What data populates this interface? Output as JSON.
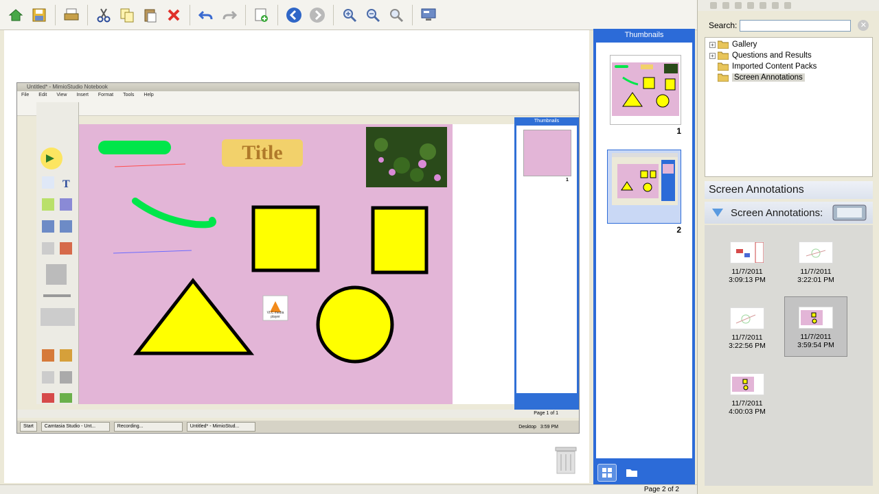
{
  "toolbar": {
    "buttons": [
      "home-icon",
      "save-icon",
      "print-icon",
      "cut-icon",
      "copy-icon",
      "paste-icon",
      "delete-icon",
      "undo-icon",
      "redo-icon",
      "new-page-icon",
      "back-icon",
      "forward-icon",
      "zoom-in-icon",
      "zoom-out-icon",
      "zoom-fit-icon",
      "screen-icon"
    ]
  },
  "embedded": {
    "window_title": "Untitled* - MimioStudio Notebook",
    "menu": [
      "File",
      "Edit",
      "View",
      "Insert",
      "Format",
      "Tools",
      "Help"
    ],
    "slide_title": "Title",
    "vlc_label": "VLC media player",
    "thumbs_header": "Thumbnails",
    "thumb_num": "1",
    "page_status": "Page 1 of 1",
    "taskbar": {
      "start": "Start",
      "items": [
        "Camtasia Studio - Unt...",
        "Recording...",
        "Untitled* - MimioStud..."
      ],
      "desktop": "Desktop",
      "clock": "3:59 PM"
    }
  },
  "thumbnails": {
    "header": "Thumbnails",
    "pages": [
      {
        "number": "1"
      },
      {
        "number": "2"
      }
    ]
  },
  "gallery": {
    "search_label": "Search:",
    "search_value": "",
    "tree": [
      {
        "label": "Gallery",
        "expandable": true
      },
      {
        "label": "Questions and Results",
        "expandable": true
      },
      {
        "label": "Imported Content Packs",
        "expandable": false
      },
      {
        "label": "Screen Annotations",
        "expandable": false,
        "selected": true
      }
    ],
    "section_title": "Screen Annotations",
    "subsection_title": "Screen Annotations:",
    "annotations": [
      {
        "date": "11/7/2011",
        "time": "3:09:13 PM"
      },
      {
        "date": "11/7/2011",
        "time": "3:22:01 PM"
      },
      {
        "date": "11/7/2011",
        "time": "3:22:56 PM"
      },
      {
        "date": "11/7/2011",
        "time": "3:59:54 PM"
      },
      {
        "date": "11/7/2011",
        "time": "4:00:03 PM"
      }
    ]
  },
  "status": {
    "page": "Page 2 of 2"
  },
  "colors": {
    "accent": "#2c6bd8",
    "page_bg": "#e3b5d7",
    "shape_fill": "#ffff00"
  }
}
